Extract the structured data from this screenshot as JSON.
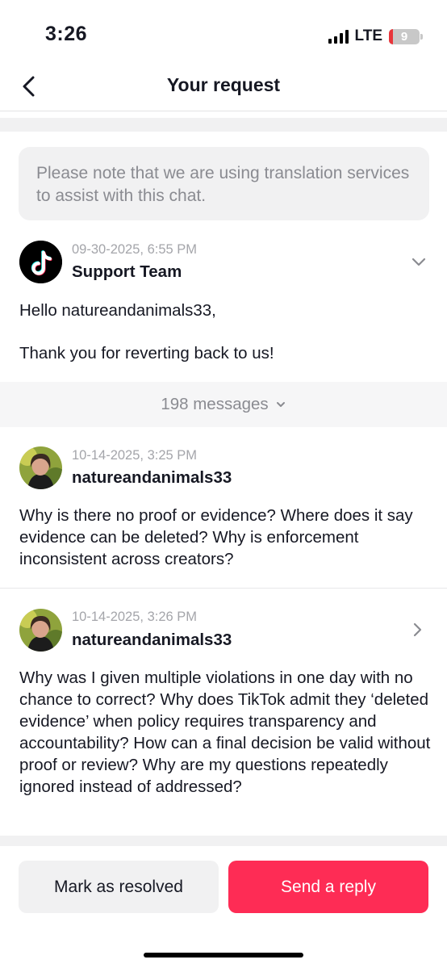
{
  "status_bar": {
    "time": "3:26",
    "network": "LTE",
    "battery_level": "9",
    "battery_fraction": 0.09,
    "battery_color": "#e8353b"
  },
  "nav": {
    "back_icon": "chevron-left-icon",
    "title": "Your request"
  },
  "notice": {
    "text": "Please note that we are using translation services to assist with this chat."
  },
  "messages": [
    {
      "date": "09-30-2025, 6:55 PM",
      "author": "Support Team",
      "avatar": "tiktok-logo",
      "greeting": "Hello natureandanimals33,",
      "body": "Thank you for reverting back to us!",
      "toggle_icon": "chevron-down-icon"
    },
    {
      "date": "10-14-2025, 3:25 PM",
      "author": "natureandanimals33",
      "avatar": "user-photo",
      "body": "Why is there no proof or evidence? Where does it say evidence can be deleted? Why is enforcement inconsistent across creators?"
    },
    {
      "date": "10-14-2025, 3:26 PM",
      "author": "natureandanimals33",
      "avatar": "user-photo",
      "body": "Why was I given multiple violations in one day with no chance to correct? Why does TikTok admit they ‘deleted evidence’ when policy requires transparency and accountability? How can a final decision be valid without proof or review? Why are my questions repeatedly ignored instead of addressed?",
      "toggle_icon": "chevron-right-icon"
    }
  ],
  "collapsed": {
    "label": "198 messages",
    "icon": "chevron-down-icon"
  },
  "actions": {
    "resolve_label": "Mark as resolved",
    "reply_label": "Send a reply"
  },
  "colors": {
    "accent": "#fe2c55",
    "muted_text": "#8a8b91",
    "surface": "#f1f1f2"
  }
}
